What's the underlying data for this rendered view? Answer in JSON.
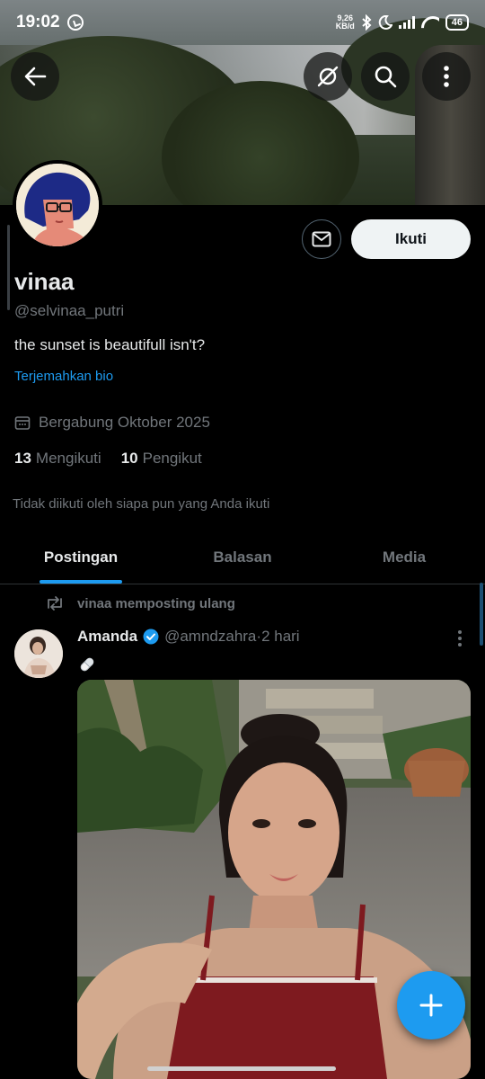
{
  "status_bar": {
    "time": "19:02",
    "net_speed_value": "9,26",
    "net_speed_unit": "KB/d",
    "battery": "46",
    "icons": [
      "whatsapp-icon",
      "bluetooth-icon",
      "moon-icon",
      "signal-icon",
      "wifi-icon",
      "battery-icon"
    ]
  },
  "header": {
    "icons": [
      "back-arrow-icon",
      "grok-icon",
      "search-icon",
      "more-vertical-icon"
    ]
  },
  "profile": {
    "display_name": "vinaa",
    "handle": "@selvinaa_putri",
    "bio": "the sunset is beautifull isn't?",
    "translate_label": "Terjemahkan bio",
    "joined": "Bergabung Oktober 2025",
    "following_count": "13",
    "following_label": "Mengikuti",
    "followers_count": "10",
    "followers_label": "Pengikut",
    "not_followed_text": "Tidak diikuti oleh siapa pun yang Anda ikuti",
    "follow_button": "Ikuti"
  },
  "tabs": [
    {
      "label": "Postingan",
      "active": true
    },
    {
      "label": "Balasan",
      "active": false
    },
    {
      "label": "Media",
      "active": false
    }
  ],
  "post": {
    "repost_text": "vinaa memposting ulang",
    "author_name": "Amanda",
    "author_handle": "@amndzahra",
    "separator": " · ",
    "time": "2 hari",
    "emoji": "pill-emoji"
  },
  "colors": {
    "accent": "#1d9bf0",
    "background": "#000000",
    "secondary_text": "#71767b"
  }
}
